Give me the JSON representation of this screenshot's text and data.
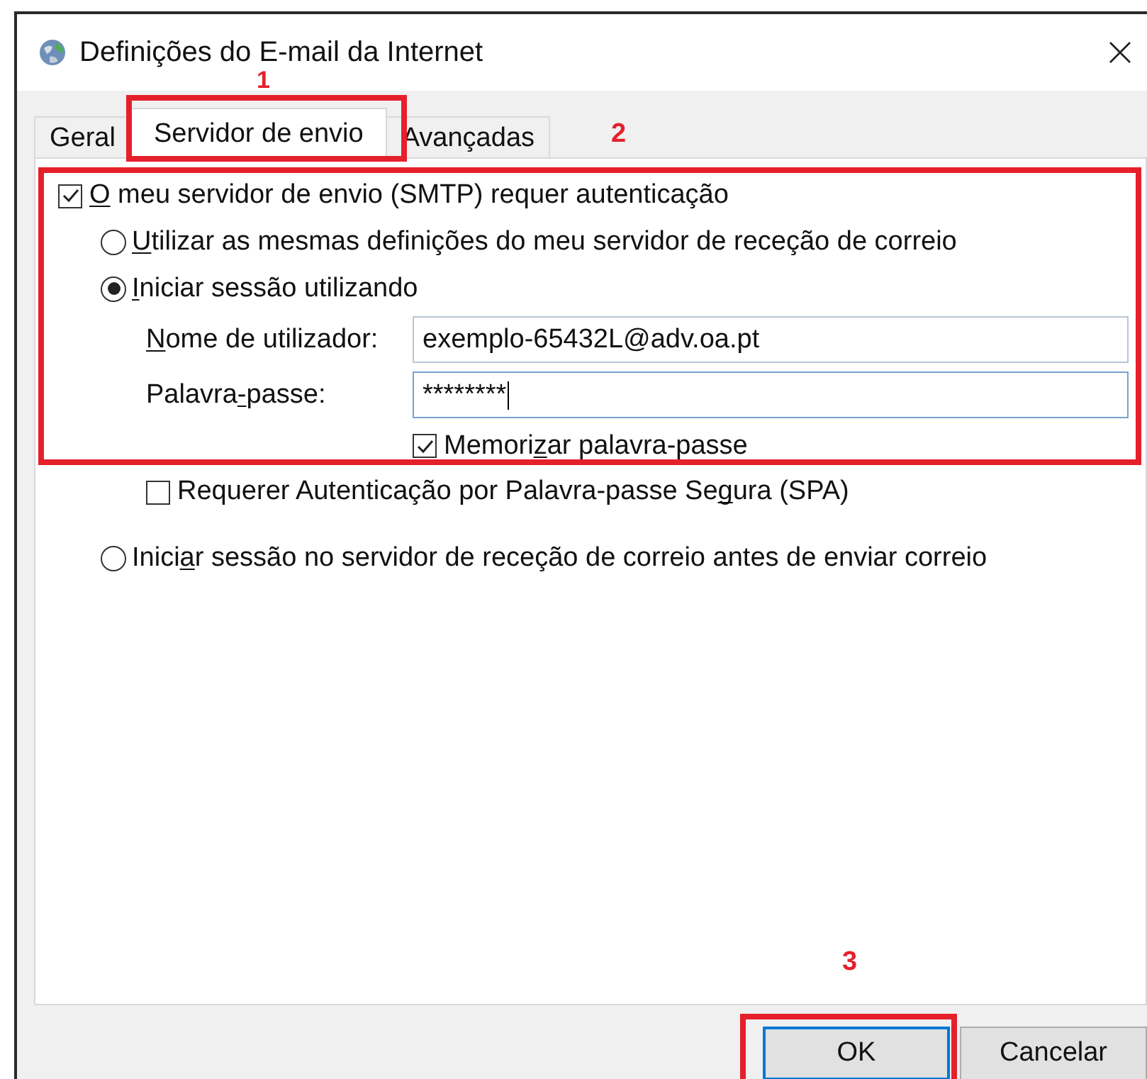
{
  "window": {
    "title": "Definições do E-mail da Internet"
  },
  "tabs": [
    {
      "label": "Geral",
      "selected": false,
      "highlighted": false
    },
    {
      "label": "Servidor de envio",
      "selected": true,
      "highlighted": true
    },
    {
      "label": "Avançadas",
      "selected": false,
      "highlighted": false
    }
  ],
  "options": [
    {
      "kind": "checkbox",
      "checked": true,
      "highlighted": true,
      "label": [
        {
          "text": "O",
          "underline": true
        },
        {
          "text": " meu servidor de envio (SMTP) requer autenticação",
          "underline": false
        }
      ],
      "children": [
        {
          "kind": "radio",
          "selected": false,
          "label": [
            {
              "text": "U",
              "underline": true
            },
            {
              "text": "tilizar as mesmas definições do meu servidor de receção de correio",
              "underline": false
            }
          ]
        },
        {
          "kind": "radio",
          "selected": true,
          "label": [
            {
              "text": "I",
              "underline": true
            },
            {
              "text": "niciar sessão utilizando",
              "underline": false
            }
          ],
          "children": [
            {
              "kind": "field",
              "label": [
                {
                  "text": "N",
                  "underline": true
                },
                {
                  "text": "ome de utilizador:",
                  "underline": false
                }
              ],
              "value": "exemplo-65432L@adv.oa.pt",
              "focused": false
            },
            {
              "kind": "field",
              "label": [
                {
                  "text": "Palavra",
                  "underline": false
                },
                {
                  "text": "-",
                  "underline": true
                },
                {
                  "text": "passe:",
                  "underline": false
                }
              ],
              "value": "********",
              "focused": true
            },
            {
              "kind": "field_checkbox",
              "checked": true,
              "label": [
                {
                  "text": "Memori",
                  "underline": false
                },
                {
                  "text": "z",
                  "underline": true
                },
                {
                  "text": "ar palavra-passe",
                  "underline": false
                }
              ]
            },
            {
              "kind": "checkbox",
              "checked": false,
              "label": [
                {
                  "text": "Requerer Autenticação por Palavra-passe Se",
                  "underline": false
                },
                {
                  "text": "g",
                  "underline": true
                },
                {
                  "text": "ura (SPA)",
                  "underline": false
                }
              ]
            }
          ]
        },
        {
          "kind": "radio",
          "selected": false,
          "label": [
            {
              "text": "Inici",
              "underline": false
            },
            {
              "text": "a",
              "underline": true
            },
            {
              "text": "r sessão no servidor de receção de correio antes de enviar correio",
              "underline": false
            }
          ]
        }
      ]
    }
  ],
  "buttons": [
    {
      "label": "OK",
      "default": true,
      "highlighted": true
    },
    {
      "label": "Cancelar",
      "default": false,
      "highlighted": false
    }
  ],
  "markers": [
    "1",
    "2",
    "3"
  ]
}
